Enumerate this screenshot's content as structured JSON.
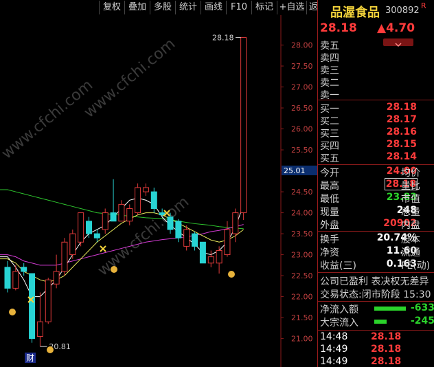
{
  "toolbar": {
    "buttons": [
      "复权",
      "叠加",
      "多股",
      "统计",
      "画线",
      "F10",
      "标记",
      "+自选",
      "返回"
    ]
  },
  "stock": {
    "name": "品渥食品",
    "code": "300892",
    "badge": "R",
    "price": "28.18",
    "change": "▲4.70",
    "arrow_icon": "chevron-down-icon"
  },
  "order_book": {
    "sell": [
      {
        "label": "卖五",
        "price": ""
      },
      {
        "label": "卖四",
        "price": ""
      },
      {
        "label": "卖三",
        "price": ""
      },
      {
        "label": "卖二",
        "price": ""
      },
      {
        "label": "卖一",
        "price": ""
      }
    ],
    "buy": [
      {
        "label": "买一",
        "price": "28.18"
      },
      {
        "label": "买二",
        "price": "28.17"
      },
      {
        "label": "买三",
        "price": "28.16"
      },
      {
        "label": "买四",
        "price": "28.15"
      },
      {
        "label": "买五",
        "price": "28.14"
      }
    ]
  },
  "quote": {
    "open_label": "今开",
    "open": "24.00",
    "open_right": "均价",
    "high_label": "最高",
    "high": "28.18",
    "high_right": "量比",
    "low_label": "最低",
    "low": "23.83",
    "low_right": "市值",
    "vol_label": "现量",
    "vol": "248",
    "vol_right": "总量",
    "outer_label": "外盘",
    "outer": "20902",
    "outer_right": "内盘",
    "turnover_label": "换手",
    "turnover": "20.74%",
    "turnover_right": "股本",
    "nav_label": "净资",
    "nav": "11.60",
    "nav_right": "流通",
    "eps_label": "收益(三)",
    "eps": "0.163",
    "eps_right": "PE(动)"
  },
  "info": {
    "line1": "公司已盈利 表决权无差异",
    "line2": "交易状态:闭市阶段 15:30"
  },
  "flows": [
    {
      "label": "净流入额",
      "value": "-633",
      "bar": 0.7
    },
    {
      "label": "大宗流入",
      "value": "-245",
      "bar": 0.28
    }
  ],
  "ticks": [
    {
      "time": "14:48",
      "price": "28.18"
    },
    {
      "time": "14:49",
      "price": "28.18"
    },
    {
      "time": "14:49",
      "price": "28.18"
    }
  ],
  "chart_labels": {
    "high_label": "28.18",
    "low_label": "20.81",
    "price_tag": "25.01",
    "cai_label": "财",
    "watermark": "www.cfchi.com"
  },
  "chart_data": {
    "type": "candlestick",
    "ylim": [
      20.6,
      28.55
    ],
    "y_ticks": [
      21.0,
      21.5,
      22.0,
      22.5,
      23.0,
      23.5,
      24.0,
      24.5,
      25.0,
      25.5,
      26.0,
      26.5,
      27.0,
      27.5,
      28.0
    ],
    "candles": [
      {
        "o": 22.7,
        "c": 22.2,
        "h": 22.85,
        "l": 22.1
      },
      {
        "o": 22.2,
        "c": 22.6,
        "h": 22.75,
        "l": 22.15
      },
      {
        "o": 22.7,
        "c": 22.6,
        "h": 22.8,
        "l": 22.5
      },
      {
        "o": 22.55,
        "c": 21.0,
        "h": 22.55,
        "l": 20.9
      },
      {
        "o": 21.05,
        "c": 21.4,
        "h": 22.1,
        "l": 20.81
      },
      {
        "o": 21.4,
        "c": 22.4,
        "h": 22.45,
        "l": 21.35
      },
      {
        "o": 22.3,
        "c": 22.6,
        "h": 23.0,
        "l": 22.2
      },
      {
        "o": 22.6,
        "c": 23.3,
        "h": 23.4,
        "l": 22.5
      },
      {
        "o": 23.0,
        "c": 23.5,
        "h": 23.6,
        "l": 22.9
      },
      {
        "o": 23.3,
        "c": 24.0,
        "h": 24.0,
        "l": 23.2
      },
      {
        "o": 23.8,
        "c": 23.5,
        "h": 23.9,
        "l": 23.4
      },
      {
        "o": 23.5,
        "c": 23.4,
        "h": 23.6,
        "l": 23.3
      },
      {
        "o": 23.6,
        "c": 24.0,
        "h": 24.1,
        "l": 23.5
      },
      {
        "o": 24.0,
        "c": 23.8,
        "h": 24.8,
        "l": 23.8
      },
      {
        "o": 23.8,
        "c": 24.2,
        "h": 24.3,
        "l": 23.8
      },
      {
        "o": 23.8,
        "c": 24.1,
        "h": 24.2,
        "l": 23.7
      },
      {
        "o": 24.0,
        "c": 24.6,
        "h": 24.7,
        "l": 23.95
      },
      {
        "o": 24.5,
        "c": 24.6,
        "h": 24.7,
        "l": 24.4
      },
      {
        "o": 24.5,
        "c": 24.1,
        "h": 24.6,
        "l": 24.0
      },
      {
        "o": 24.0,
        "c": 23.95,
        "h": 24.1,
        "l": 23.9
      },
      {
        "o": 23.9,
        "c": 23.6,
        "h": 24.0,
        "l": 23.5
      },
      {
        "o": 23.8,
        "c": 23.4,
        "h": 23.85,
        "l": 23.3
      },
      {
        "o": 23.2,
        "c": 23.6,
        "h": 23.7,
        "l": 23.1
      },
      {
        "o": 23.5,
        "c": 23.2,
        "h": 23.55,
        "l": 23.1
      },
      {
        "o": 23.3,
        "c": 22.8,
        "h": 23.3,
        "l": 22.8
      },
      {
        "o": 22.8,
        "c": 22.95,
        "h": 23.1,
        "l": 22.7
      },
      {
        "o": 22.8,
        "c": 23.1,
        "h": 23.2,
        "l": 22.55
      },
      {
        "o": 23.0,
        "c": 23.6,
        "h": 23.8,
        "l": 22.95
      },
      {
        "o": 23.5,
        "c": 24.0,
        "h": 24.1,
        "l": 23.3
      },
      {
        "o": 24.0,
        "c": 28.18,
        "h": 28.18,
        "l": 23.83
      }
    ],
    "ma_white": [
      22.95,
      22.7,
      22.4,
      22.0,
      22.0,
      22.2,
      22.4,
      22.7,
      23.0,
      23.3,
      23.5,
      23.6,
      23.7,
      23.9,
      24.1,
      24.3,
      24.35,
      24.3,
      24.2,
      23.9,
      23.7,
      23.55,
      23.4,
      23.25,
      23.05,
      23.0,
      23.1,
      23.3,
      23.65,
      24.2
    ],
    "ma_yellow": [
      22.9,
      22.8,
      22.6,
      22.5,
      22.4,
      22.35,
      22.4,
      22.5,
      22.7,
      22.9,
      23.1,
      23.3,
      23.45,
      23.6,
      23.75,
      23.85,
      23.95,
      24.0,
      24.0,
      23.95,
      23.85,
      23.75,
      23.65,
      23.55,
      23.45,
      23.35,
      23.3,
      23.35,
      23.45,
      23.6
    ],
    "ma_purple": [
      23.0,
      22.95,
      22.85,
      22.8,
      22.75,
      22.75,
      22.75,
      22.8,
      22.85,
      22.9,
      22.95,
      23.0,
      23.05,
      23.1,
      23.15,
      23.2,
      23.25,
      23.3,
      23.33,
      23.36,
      23.38,
      23.4,
      23.43,
      23.46,
      23.5,
      23.55,
      23.58,
      23.62,
      23.67,
      23.72
    ],
    "ma_green": [
      24.55,
      24.5,
      24.45,
      24.4,
      24.35,
      24.3,
      24.25,
      24.2,
      24.15,
      24.1,
      24.05,
      24.0,
      23.98,
      23.96,
      23.94,
      23.92,
      23.9,
      23.88,
      23.87,
      23.86,
      23.84,
      23.8,
      23.77,
      23.74,
      23.72,
      23.7,
      23.67,
      23.65,
      23.63,
      23.62
    ]
  },
  "colors": {
    "up": "#e23b3b",
    "down": "#28d4d4",
    "ma_white": "#ffffff",
    "ma_yellow": "#e8e85a",
    "ma_purple": "#d33bd3",
    "ma_green": "#2ec52e",
    "grid": "#8a1a1a"
  }
}
